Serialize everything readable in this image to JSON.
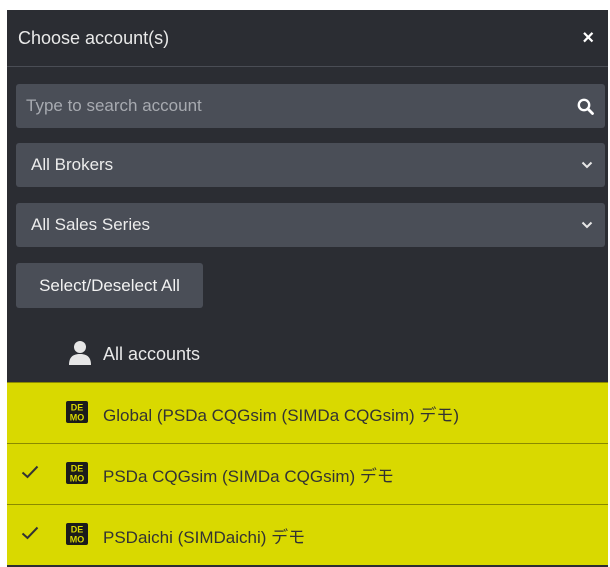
{
  "dialog": {
    "title": "Choose account(s)",
    "close_glyph": "×"
  },
  "search": {
    "placeholder": "Type to search account",
    "value": ""
  },
  "filters": {
    "brokers": "All Brokers",
    "sales_series": "All Sales Series"
  },
  "select_all_label": "Select/Deselect All",
  "all_accounts_label": "All accounts",
  "accounts": [
    {
      "label": "Global (PSDa CQGsim (SIMDa CQGsim) デモ)",
      "checked": false,
      "badge": "DE MO"
    },
    {
      "label": "PSDa CQGsim (SIMDa CQGsim) デモ",
      "checked": true,
      "badge": "DE MO"
    },
    {
      "label": "PSDaichi (SIMDaichi) デモ",
      "checked": true,
      "badge": "DE MO"
    }
  ],
  "colors": {
    "panel_bg": "#2b2d33",
    "field_bg": "#4a4e57",
    "selected_row": "#d9d900"
  }
}
